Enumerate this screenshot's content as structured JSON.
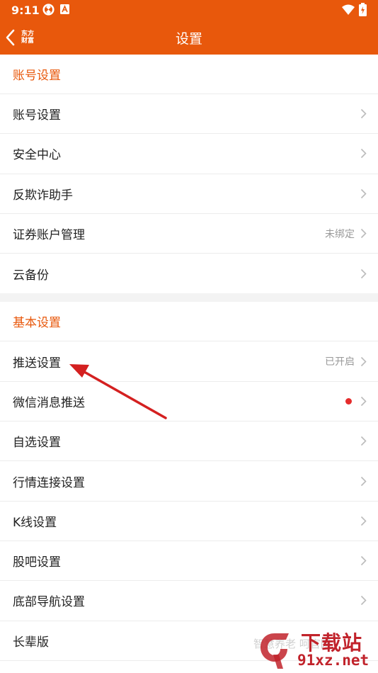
{
  "status_bar": {
    "time": "9:11",
    "icons": [
      "sync-icon",
      "a-badge-icon",
      "wifi-icon",
      "battery-icon"
    ]
  },
  "nav": {
    "title": "设置",
    "back_icon": "chevron-left-icon",
    "logo_line1": "东方",
    "logo_line2": "财富"
  },
  "sections": [
    {
      "header": "账号设置",
      "items": [
        {
          "label": "账号设置",
          "value": ""
        },
        {
          "label": "安全中心",
          "value": ""
        },
        {
          "label": "反欺诈助手",
          "value": ""
        },
        {
          "label": "证券账户管理",
          "value": "未绑定"
        },
        {
          "label": "云备份",
          "value": ""
        }
      ]
    },
    {
      "header": "基本设置",
      "items": [
        {
          "label": "推送设置",
          "value": "已开启"
        },
        {
          "label": "微信消息推送",
          "value": "",
          "dot": true
        },
        {
          "label": "自选设置",
          "value": ""
        },
        {
          "label": "行情连接设置",
          "value": ""
        },
        {
          "label": "K线设置",
          "value": ""
        },
        {
          "label": "股吧设置",
          "value": ""
        },
        {
          "label": "底部导航设置",
          "value": ""
        },
        {
          "label": "长辈版",
          "value": ""
        }
      ]
    }
  ],
  "watermark": {
    "slogan": "智慧养老 呵官网",
    "brand": "下载站",
    "domain": "91xz.net"
  },
  "colors": {
    "brand": "#e8580c",
    "dot": "#e52c2c",
    "arrow": "#d42020",
    "watermark": "#c1232b"
  }
}
